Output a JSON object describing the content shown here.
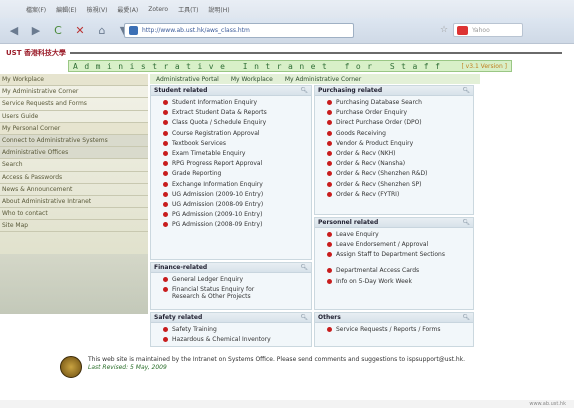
{
  "menu": [
    "檔案(F)",
    "編輯(E)",
    "檢視(V)",
    "最愛(A)",
    "Zotero",
    "工具(T)",
    "說明(H)"
  ],
  "address": {
    "url": "http://www.ab.ust.hk/aws_class.htm"
  },
  "search": {
    "placeholder": "Yahoo"
  },
  "header": {
    "logo_text": "UST 香港科技大學",
    "banner_title": "Administrative Intranet for Staff",
    "banner_version": "[ v3.1 Version ]"
  },
  "tabs": [
    "Administrative Portal",
    "My Workplace",
    "My Administrative Corner"
  ],
  "sidebar": [
    "My Workplace",
    "My Administrative Corner",
    "Service Requests and Forms",
    "Users Guide",
    "My Personal Corner",
    "Connect to Administrative Systems",
    "Administrative Offices",
    "Search",
    "Access & Passwords",
    "News & Announcement",
    "About Administrative Intranet",
    "Who to contact",
    "Site Map"
  ],
  "panels": {
    "student": {
      "title": "Student related",
      "items": [
        "Student Information Enquiry",
        "Extract Student Data & Reports",
        "Class Quota / Schedule Enquiry",
        "Course Registration Approval",
        "Textbook Services",
        "Exam Timetable Enquiry",
        "RPG Progress Report Approval",
        "Grade Reporting",
        "Exchange Information Enquiry",
        "UG Admission (2009-10 Entry)",
        "UG Admission (2008-09 Entry)",
        "PG Admission (2009-10 Entry)",
        "PG Admission (2008-09 Entry)"
      ]
    },
    "purchasing": {
      "title": "Purchasing related",
      "items": [
        "Purchasing Database Search",
        "Purchase Order Enquiry",
        "Direct Purchase Order (DPO)",
        "Goods Receiving",
        "Vendor & Product Enquiry",
        "Order & Recv (NKH)",
        "Order & Recv (Nansha)",
        "Order & Recv (Shenzhen R&D)",
        "Order & Recv (Shenzhen SP)",
        "Order & Recv (FYTRI)"
      ]
    },
    "personnel": {
      "title": "Personnel related",
      "items": [
        "Leave Enquiry",
        "Leave Endorsement / Approval",
        "Assign Staff to Department Sections",
        "Departmental Access Cards",
        "Info on 5-Day Work Week"
      ]
    },
    "finance": {
      "title": "Finance-related",
      "items": [
        "General Ledger Enquiry",
        "Financial Status Enquiry for Research & Other Projects"
      ]
    },
    "safety": {
      "title": "Safety related",
      "items": [
        "Safety Training",
        "Hazardous & Chemical Inventory"
      ]
    },
    "others": {
      "title": "Others",
      "items": [
        "Service Requests / Reports / Forms"
      ]
    }
  },
  "footer": {
    "text": "This web site is maintained by the Intranet on Systems Office. Please send comments and suggestions to ispsupport@ust.hk.",
    "revised": "Last Revised: 5 May, 2009"
  },
  "status": {
    "text": "www.ab.ust.hk"
  }
}
